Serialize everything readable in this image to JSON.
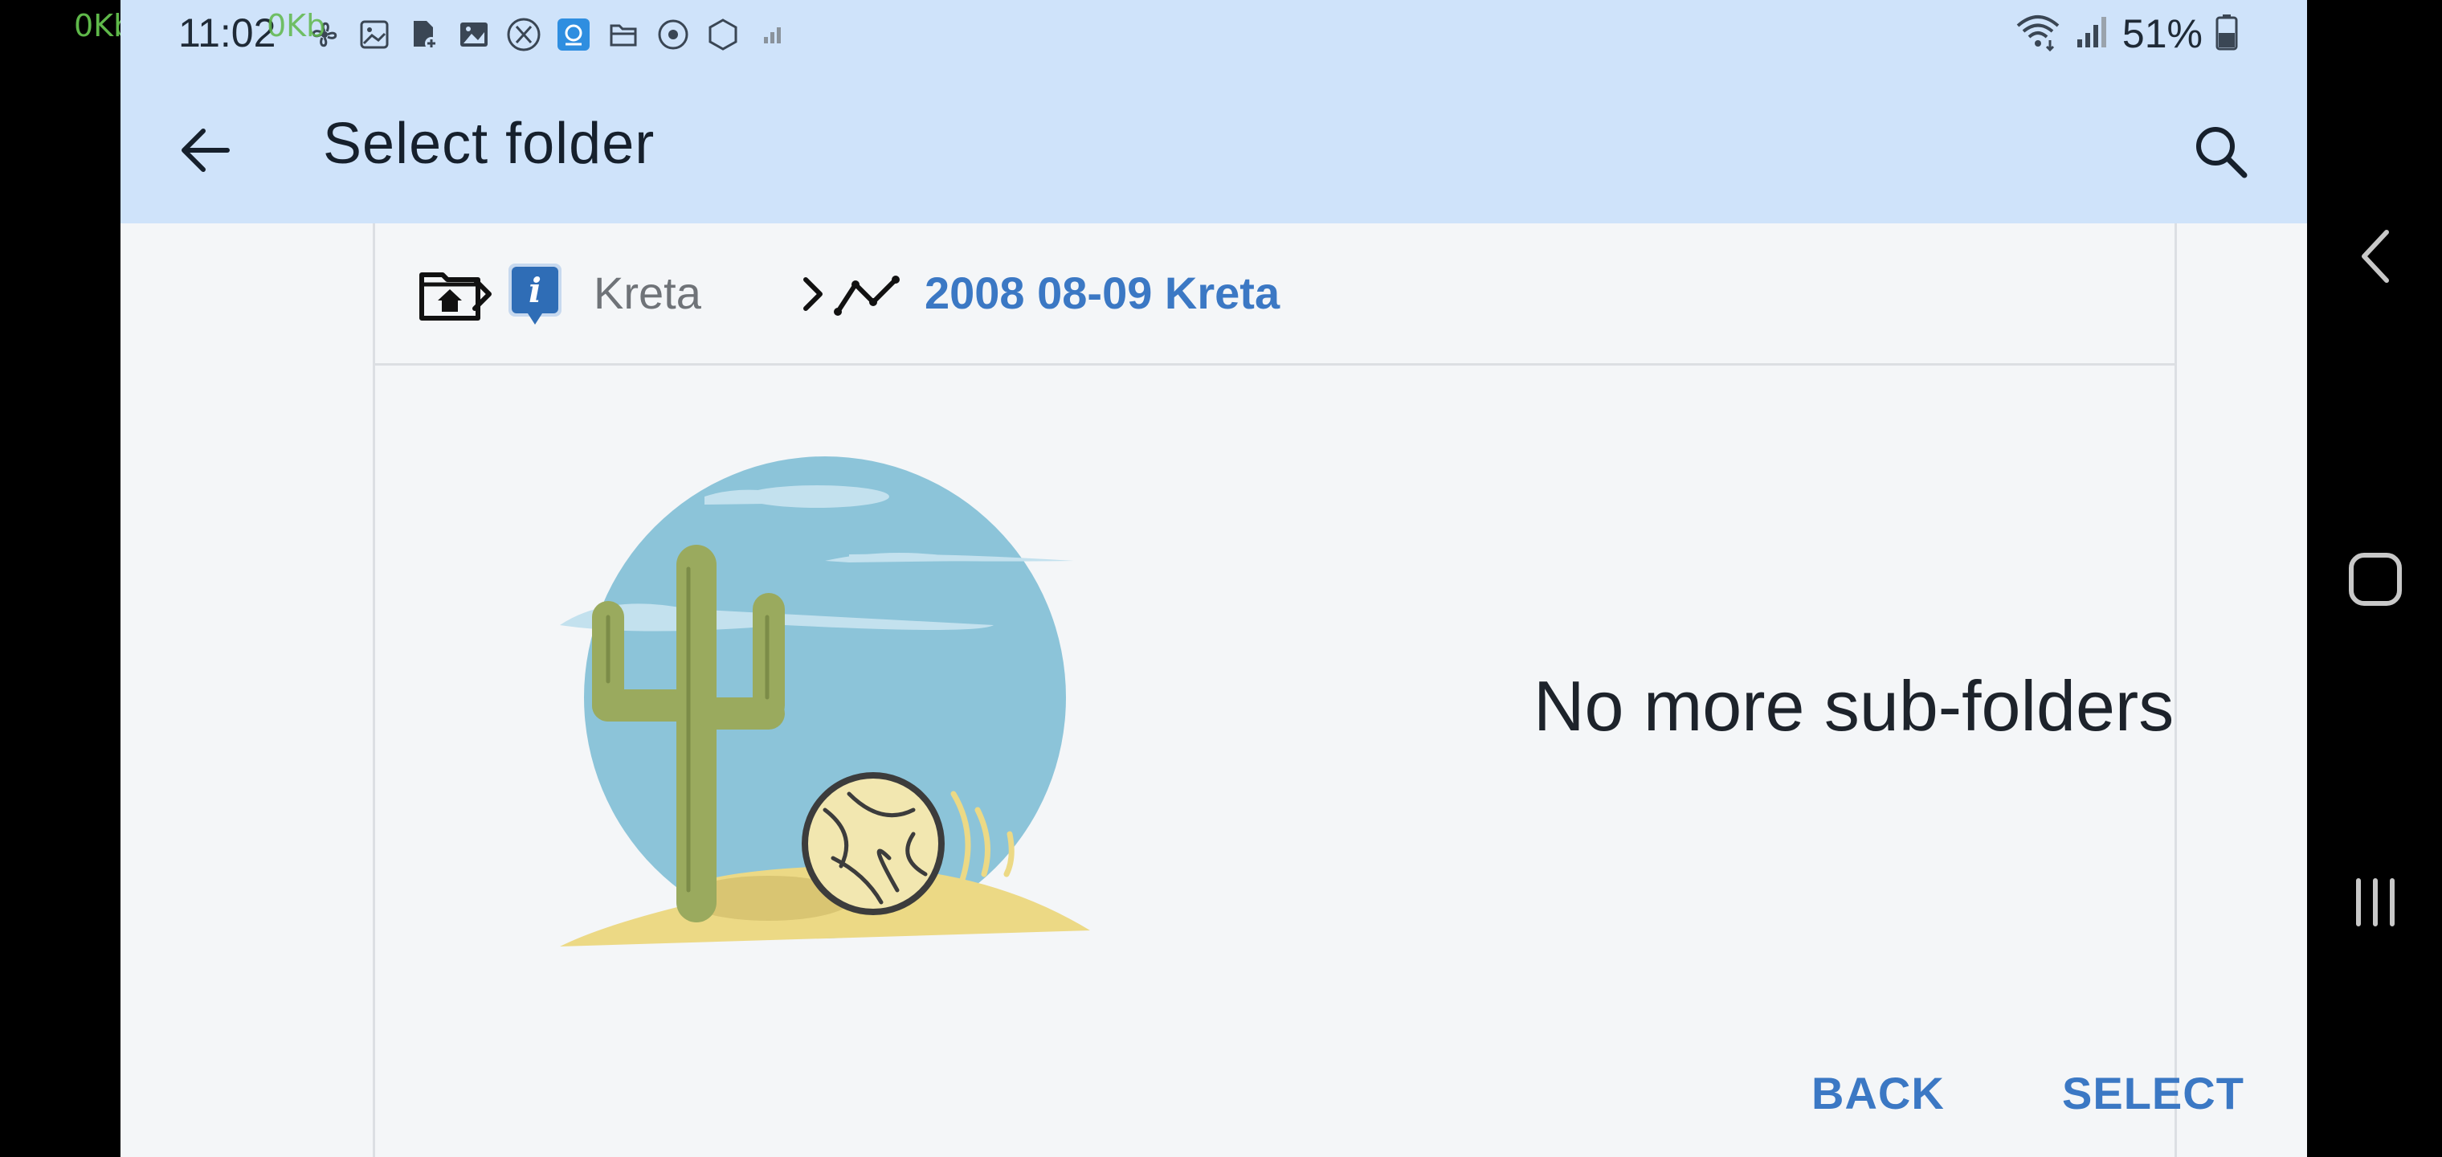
{
  "status_bar": {
    "net_speed_left": "0Kb",
    "net_speed_overlay": "0Kb",
    "time": "11:02",
    "battery_percent": "51%",
    "icons": [
      "fan-icon",
      "gallery-icon",
      "file-add-icon",
      "image-icon",
      "x-icon",
      "app-icon",
      "files-icon",
      "target-icon",
      "hexagon-icon",
      "signal-small-icon"
    ]
  },
  "toolbar": {
    "title": "Select folder",
    "back_icon": "arrow-left-icon",
    "search_icon": "search-icon"
  },
  "breadcrumb": {
    "items": [
      {
        "icon": "folder-home-icon"
      },
      {
        "icon": "info-marker-icon",
        "label": "Kreta"
      },
      {
        "icon": "track-icon",
        "label": "2008 08-09 Kreta"
      }
    ]
  },
  "empty_state": {
    "message": "No more sub-folders",
    "illustration": "desert-cactus-tumbleweed"
  },
  "actions": {
    "back_label": "BACK",
    "select_label": "SELECT"
  },
  "colors": {
    "accent": "#3b78c4",
    "header_bg": "#cfe3fa",
    "content_bg": "#f4f6f8"
  },
  "nav_bar": {
    "icons": [
      "nav-back-icon",
      "nav-home-icon",
      "nav-recents-icon"
    ]
  }
}
